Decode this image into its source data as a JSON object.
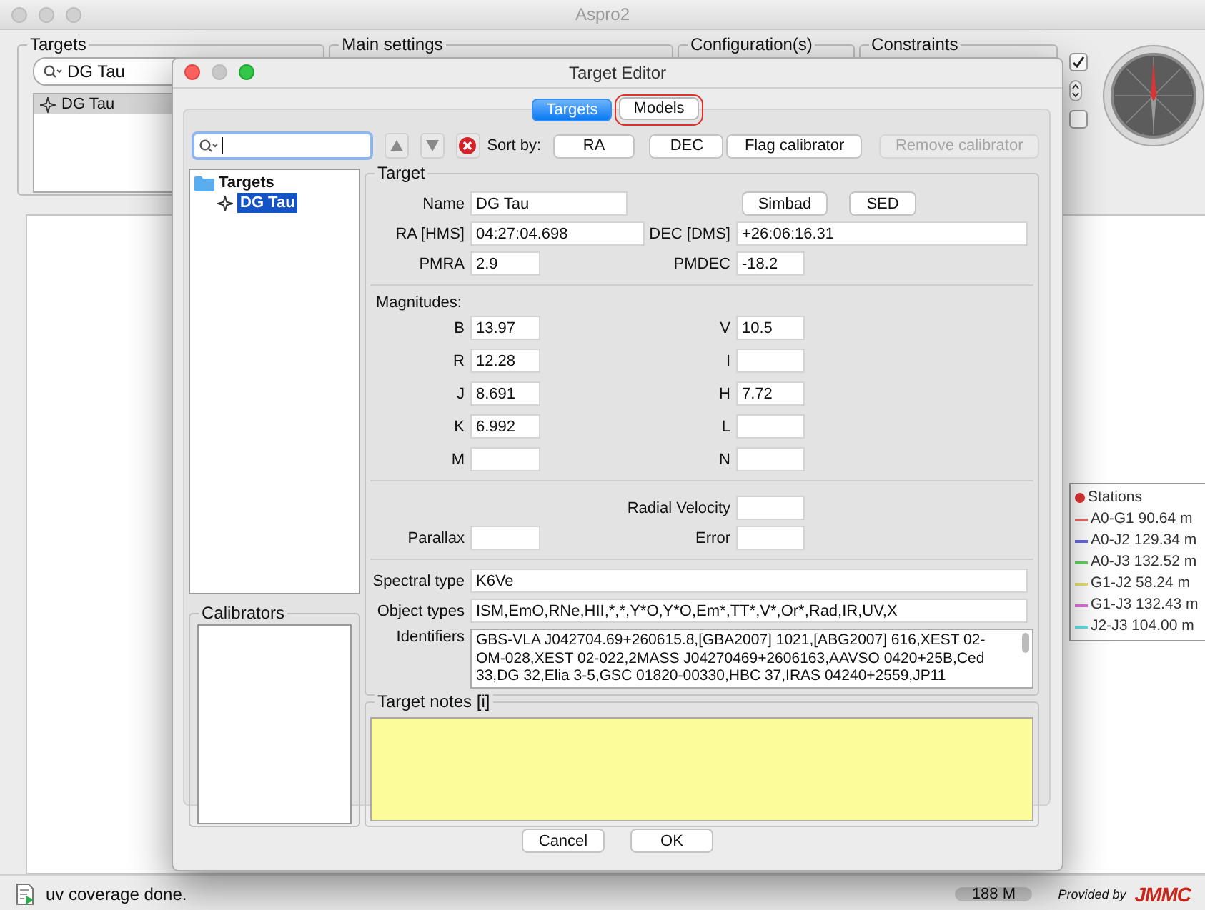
{
  "main_window": {
    "title": "Aspro2",
    "panels": [
      {
        "title": "Targets"
      },
      {
        "title": "Main settings"
      },
      {
        "title": "Configuration(s)"
      },
      {
        "title": "Constraints"
      }
    ],
    "target_search": {
      "value": "DG Tau"
    },
    "target_list": [
      {
        "label": "DG Tau",
        "selected": true
      }
    ],
    "options": [
      {
        "checked": true
      },
      {
        "checked": false
      }
    ],
    "legend": {
      "title": "Stations",
      "items": [
        {
          "label": "A0-G1 90.64 m",
          "color": "#e07070"
        },
        {
          "label": "A0-J2 129.34 m",
          "color": "#6a6ae0"
        },
        {
          "label": "A0-J3 132.52 m",
          "color": "#66d066"
        },
        {
          "label": "G1-J2 58.24 m",
          "color": "#e8e070"
        },
        {
          "label": "G1-J3 132.43 m",
          "color": "#e070e0"
        },
        {
          "label": "J2-J3 104.00 m",
          "color": "#66e0e0"
        }
      ]
    }
  },
  "dialog": {
    "title": "Target Editor",
    "tabs": [
      {
        "label": "Targets",
        "selected": true,
        "highlighted": false
      },
      {
        "label": "Models",
        "selected": false,
        "highlighted": true
      }
    ],
    "toolbar": {
      "sort_label": "Sort by:",
      "buttons": [
        {
          "label": "RA",
          "disabled": false
        },
        {
          "label": "DEC",
          "disabled": false
        },
        {
          "label": "Flag calibrator",
          "disabled": false
        },
        {
          "label": "Remove calibrator",
          "disabled": true
        }
      ]
    },
    "tree": [
      {
        "label": "Targets",
        "kind": "folder",
        "selected": false,
        "children": [
          {
            "label": "DG Tau",
            "kind": "target",
            "selected": true
          }
        ]
      }
    ],
    "calibrators": {
      "title": "Calibrators"
    },
    "target": {
      "title": "Target",
      "name": {
        "label": "Name",
        "value": "DG Tau"
      },
      "lookup_buttons": [
        "Simbad",
        "SED"
      ],
      "ra": {
        "label": "RA [HMS]",
        "value": "04:27:04.698"
      },
      "dec": {
        "label": "DEC [DMS]",
        "value": "+26:06:16.31"
      },
      "pmra": {
        "label": "PMRA",
        "value": "2.9"
      },
      "pmdec": {
        "label": "PMDEC",
        "value": "-18.2"
      },
      "magnitudes_label": "Magnitudes:",
      "magnitudes": [
        {
          "band": "B",
          "value": "13.97"
        },
        {
          "band": "V",
          "value": "10.5"
        },
        {
          "band": "R",
          "value": "12.28"
        },
        {
          "band": "I"
        },
        {
          "band": "J",
          "value": "8.691"
        },
        {
          "band": "H",
          "value": "7.72"
        },
        {
          "band": "K",
          "value": "6.992"
        },
        {
          "band": "L"
        },
        {
          "band": "M"
        },
        {
          "band": "N"
        }
      ],
      "radial_velocity": {
        "label": "Radial Velocity"
      },
      "parallax": {
        "label": "Parallax"
      },
      "error": {
        "label": "Error"
      },
      "spectral_type": {
        "label": "Spectral type",
        "value": "K6Ve"
      },
      "object_types": {
        "label": "Object types",
        "value": "ISM,EmO,RNe,HII,*,*,Y*O,Y*O,Em*,TT*,V*,Or*,Rad,IR,UV,X"
      },
      "identifiers": {
        "label": "Identifiers",
        "value": "GBS-VLA J042704.69+260615.8,[GBA2007] 1021,[ABG2007] 616,XEST 02-OM-028,XEST 02-022,2MASS J04270469+2606163,AAVSO 0420+25B,Ced 33,DG 32,Elia 3-5,GSC 01820-00330,HBC 37,IRAS 04240+2559,JP11"
      }
    },
    "notes": {
      "title": "Target notes [i]"
    },
    "buttons": [
      "Cancel",
      "OK"
    ]
  },
  "status_bar": {
    "message": "uv coverage done.",
    "memory": "188 M",
    "provided_by": "Provided by",
    "logo": "JMMC"
  }
}
